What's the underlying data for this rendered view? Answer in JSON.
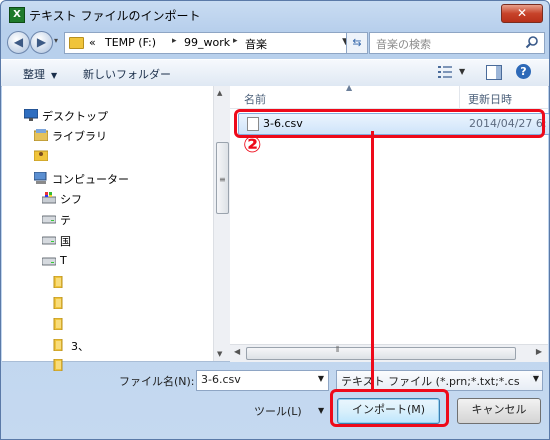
{
  "window": {
    "title": "テキスト ファイルのインポート",
    "app_icon": "excel-icon",
    "close_label": "✕"
  },
  "navbar": {
    "dropdown_label": "▾",
    "breadcrumb_prefix": "«",
    "breadcrumbs": [
      "TEMP (F:)",
      "99_work",
      "音楽"
    ],
    "search_placeholder": "音楽の検索"
  },
  "toolbar": {
    "organize": "整理",
    "new_folder": "新しいフォルダー"
  },
  "nav_pane": {
    "items": [
      {
        "label": "デスクトップ",
        "icon": "desktop-icon"
      },
      {
        "label": "ライブラリ",
        "icon": "library-icon"
      },
      {
        "label": "",
        "icon": "user-folder-icon"
      },
      {
        "label": "コンピューター",
        "icon": "computer-icon"
      },
      {
        "label": "シフ",
        "icon": "system-drive-icon"
      },
      {
        "label": "テ",
        "icon": "drive-icon"
      },
      {
        "label": "国",
        "icon": "drive-icon"
      },
      {
        "label": "T",
        "icon": "drive-icon"
      },
      {
        "label": "",
        "icon": "folder-icon"
      },
      {
        "label": "",
        "icon": "folder-icon"
      },
      {
        "label": "",
        "icon": "folder-icon"
      },
      {
        "label": "3、",
        "icon": "folder-icon"
      },
      {
        "label": "",
        "icon": "folder-icon"
      }
    ]
  },
  "file_list": {
    "columns": {
      "name": "名前",
      "date": "更新日時"
    },
    "files": [
      {
        "name": "3-6.csv",
        "date": "2014/04/27 6:"
      }
    ]
  },
  "footer": {
    "filename_label": "ファイル名(N):",
    "filename_value": "3-6.csv",
    "filetype_value": "テキスト ファイル (*.prn;*.txt;*.cs",
    "tools_label": "ツール(L)",
    "import_label": "インポート(M)",
    "cancel_label": "キャンセル"
  },
  "annotation": {
    "step_marker": "②",
    "color": "#ee0a1a"
  }
}
